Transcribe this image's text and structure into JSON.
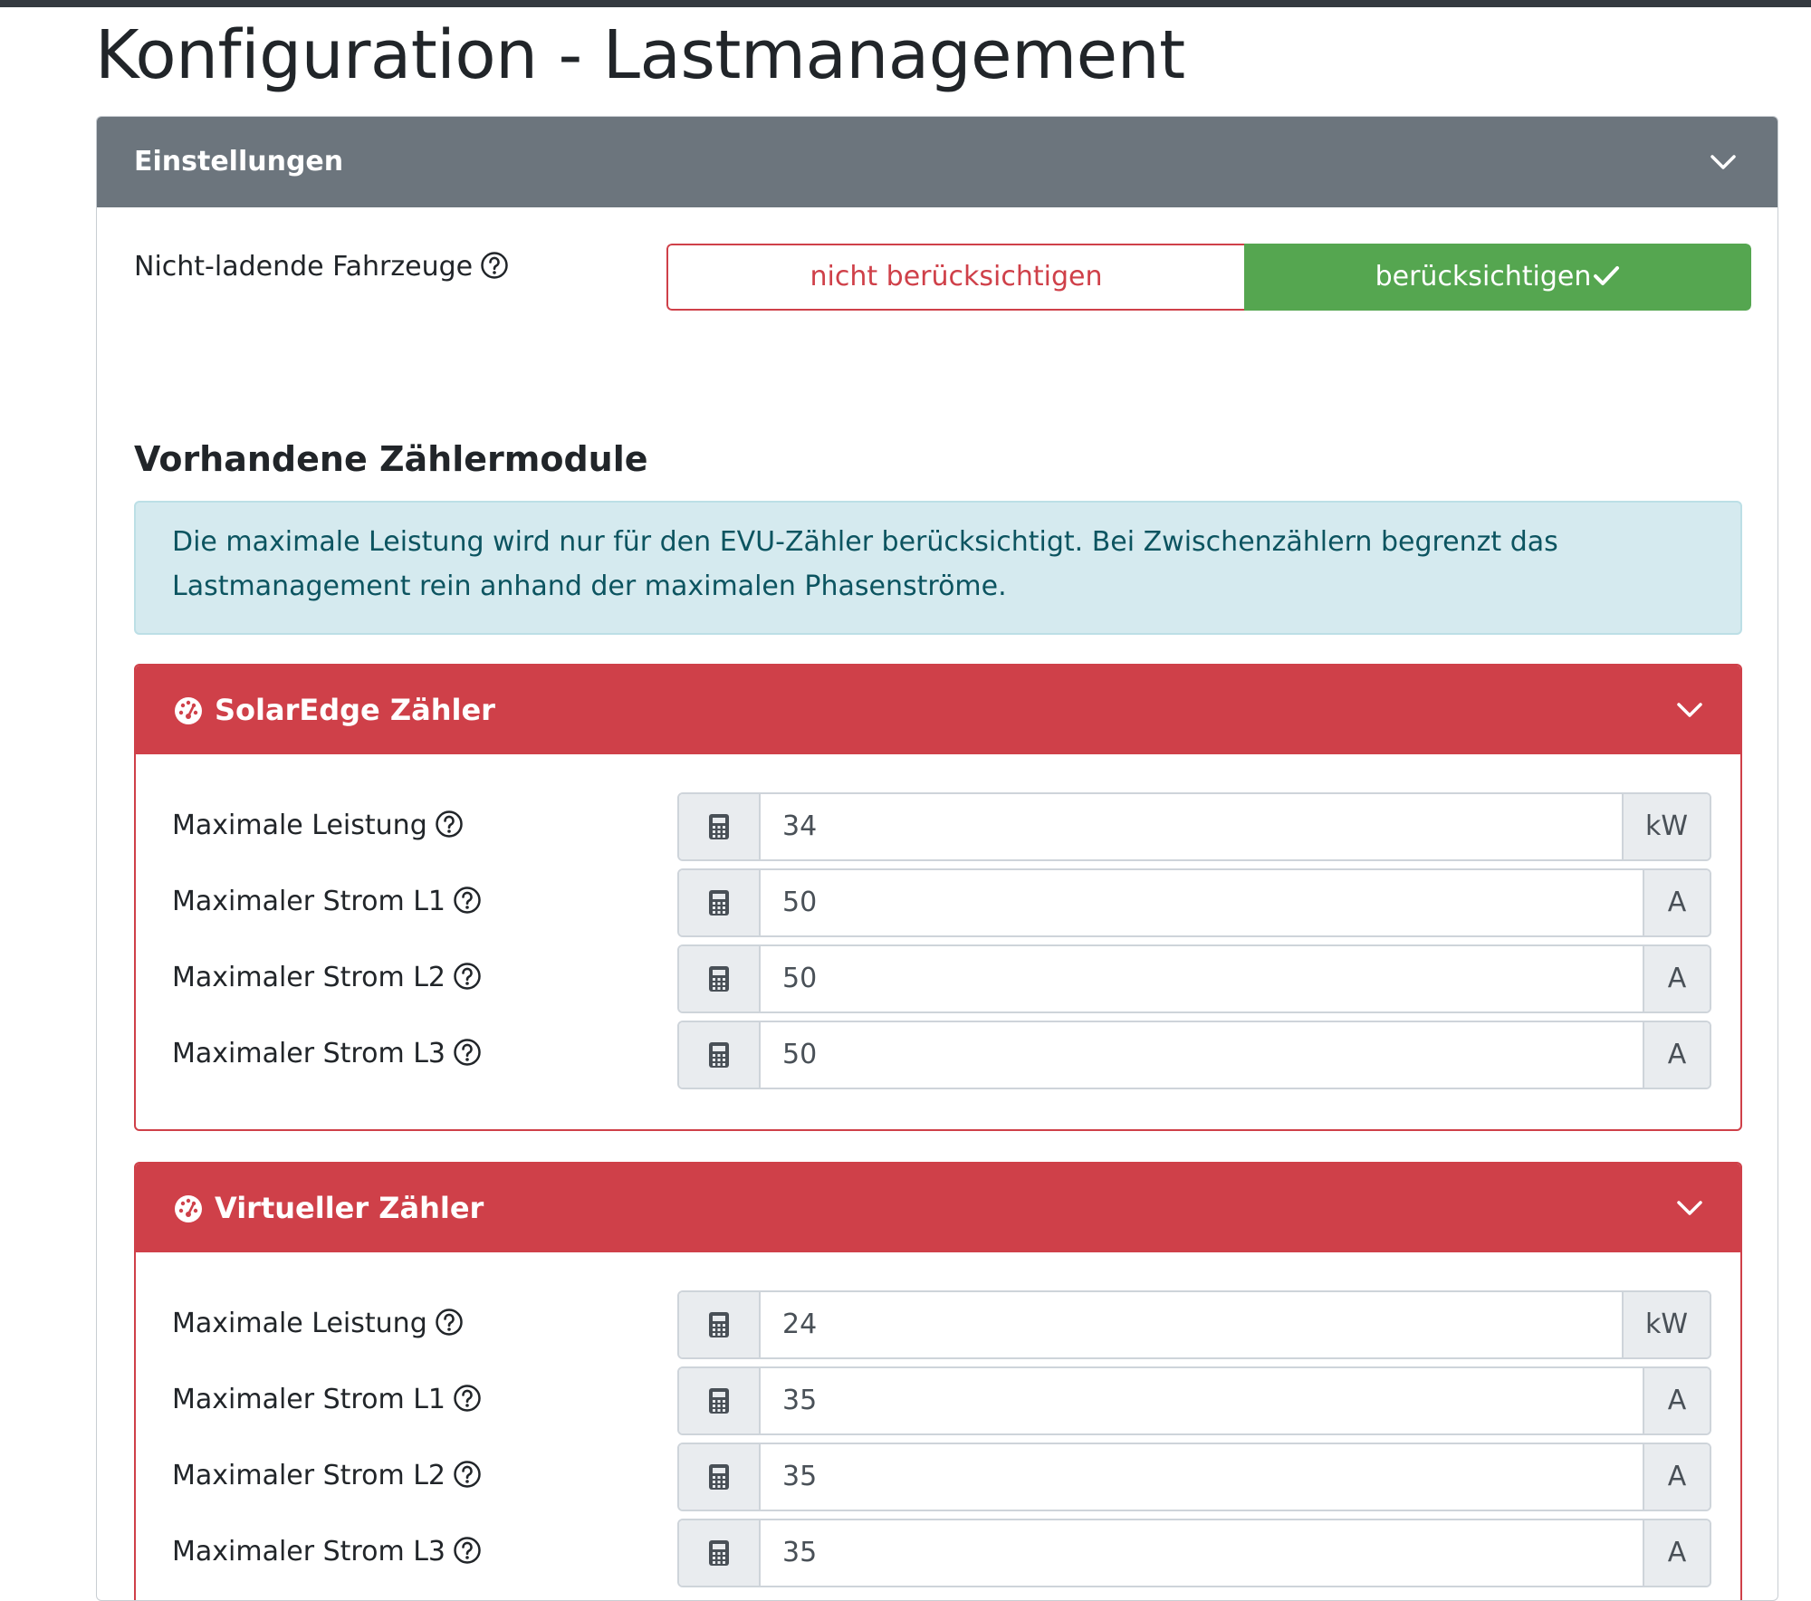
{
  "page_title": "Konfiguration - Lastmanagement",
  "settings": {
    "header": "Einstellungen",
    "non_charging_label": "Nicht-ladende Fahrzeuge",
    "toggle_off": "nicht berücksichtigen",
    "toggle_on": "berücksichtigen",
    "selected": "berücksichtigen"
  },
  "section_title": "Vorhandene Zählermodule",
  "info": "Die maximale Leistung wird nur für den EVU-Zähler berücksichtigt. Bei Zwischenzählern begrenzt das Lastmanagement rein anhand der maximalen Phasenströme.",
  "meters": [
    {
      "title": "SolarEdge Zähler",
      "fields": [
        {
          "label": "Maximale Leistung",
          "value": "34",
          "unit": "kW"
        },
        {
          "label": "Maximaler Strom L1",
          "value": "50",
          "unit": "A"
        },
        {
          "label": "Maximaler Strom L2",
          "value": "50",
          "unit": "A"
        },
        {
          "label": "Maximaler Strom L3",
          "value": "50",
          "unit": "A"
        }
      ]
    },
    {
      "title": "Virtueller Zähler",
      "fields": [
        {
          "label": "Maximale Leistung",
          "value": "24",
          "unit": "kW"
        },
        {
          "label": "Maximaler Strom L1",
          "value": "35",
          "unit": "A"
        },
        {
          "label": "Maximaler Strom L2",
          "value": "35",
          "unit": "A"
        },
        {
          "label": "Maximaler Strom L3",
          "value": "35",
          "unit": "A"
        }
      ]
    }
  ],
  "colors": {
    "header_gray": "#6c757d",
    "danger": "#cf4049",
    "success": "#55a650",
    "info_bg": "#d5eaef",
    "info_text": "#0c5460"
  },
  "icons": {
    "collapse": "chevron-down-icon",
    "help": "question-circle-icon",
    "meter": "gauge-icon",
    "calculator": "calculator-icon",
    "selected": "check-icon"
  }
}
